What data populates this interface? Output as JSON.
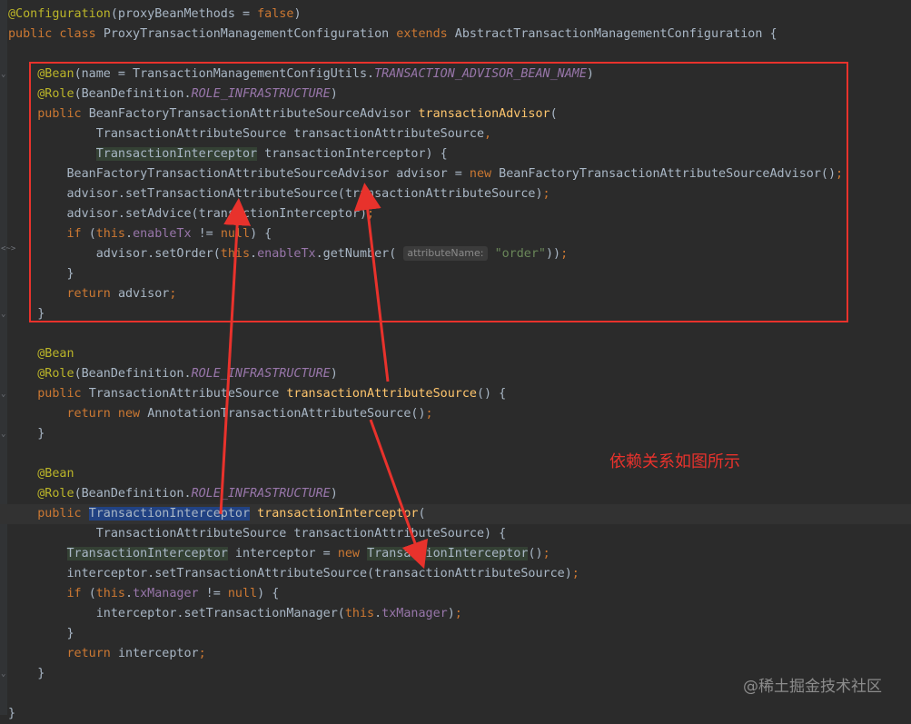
{
  "editor": {
    "lines": [
      [
        [
          "ann",
          "@Configuration"
        ],
        [
          "t",
          "(proxyBeanMethods = "
        ],
        [
          "kw",
          "false"
        ],
        [
          "t",
          ")"
        ]
      ],
      [
        [
          "kw",
          "public class "
        ],
        [
          "t",
          "ProxyTransactionManagementConfiguration "
        ],
        [
          "kw",
          "extends "
        ],
        [
          "t",
          "AbstractTransactionManagementConfiguration {"
        ]
      ],
      [],
      [
        [
          "t",
          "    "
        ],
        [
          "ann",
          "@Bean"
        ],
        [
          "t",
          "(name = TransactionManagementConfigUtils."
        ],
        [
          "cst",
          "TRANSACTION_ADVISOR_BEAN_NAME"
        ],
        [
          "t",
          ")"
        ]
      ],
      [
        [
          "t",
          "    "
        ],
        [
          "ann",
          "@Role"
        ],
        [
          "t",
          "(BeanDefinition."
        ],
        [
          "cst",
          "ROLE_INFRASTRUCTURE"
        ],
        [
          "t",
          ")"
        ]
      ],
      [
        [
          "t",
          "    "
        ],
        [
          "kw",
          "public "
        ],
        [
          "t",
          "BeanFactoryTransactionAttributeSourceAdvisor "
        ],
        [
          "meth",
          "transactionAdvisor"
        ],
        [
          "t",
          "("
        ]
      ],
      [
        [
          "t",
          "            TransactionAttributeSource transactionAttributeSource"
        ],
        [
          "kw",
          ","
        ]
      ],
      [
        [
          "t",
          "            "
        ],
        [
          "hl",
          "TransactionInterceptor"
        ],
        [
          "t",
          " transactionInterceptor) {"
        ]
      ],
      [
        [
          "t",
          "        BeanFactoryTransactionAttributeSourceAdvisor advisor = "
        ],
        [
          "kw",
          "new "
        ],
        [
          "t",
          "BeanFactoryTransactionAttributeSourceAdvisor()"
        ],
        [
          "kw",
          ";"
        ]
      ],
      [
        [
          "t",
          "        advisor.setTransactionAttributeSource(transactionAttributeSource)"
        ],
        [
          "kw",
          ";"
        ]
      ],
      [
        [
          "t",
          "        advisor.setAdvice(transactionInterceptor)"
        ],
        [
          "kw",
          ";"
        ]
      ],
      [
        [
          "t",
          "        "
        ],
        [
          "kw",
          "if "
        ],
        [
          "t",
          "("
        ],
        [
          "kw",
          "this"
        ],
        [
          "t",
          "."
        ],
        [
          "fld",
          "enableTx"
        ],
        [
          "t",
          " != "
        ],
        [
          "kw",
          "null"
        ],
        [
          "t",
          ") {"
        ]
      ],
      [
        [
          "t",
          "            advisor.setOrder("
        ],
        [
          "kw",
          "this"
        ],
        [
          "t",
          "."
        ],
        [
          "fld",
          "enableTx"
        ],
        [
          "t",
          "."
        ],
        [
          "fold",
          "<~>"
        ],
        [
          "t",
          "getNumber( "
        ],
        [
          "hint",
          "attributeName:"
        ],
        [
          "t",
          " "
        ],
        [
          "str",
          "\"order\""
        ],
        [
          "t",
          "))"
        ],
        [
          "kw",
          ";"
        ]
      ],
      [
        [
          "t",
          "        }"
        ]
      ],
      [
        [
          "t",
          "        "
        ],
        [
          "kw",
          "return "
        ],
        [
          "t",
          "advisor"
        ],
        [
          "kw",
          ";"
        ]
      ],
      [
        [
          "t",
          "    }"
        ]
      ],
      [],
      [
        [
          "t",
          "    "
        ],
        [
          "ann",
          "@Bean"
        ]
      ],
      [
        [
          "t",
          "    "
        ],
        [
          "ann",
          "@Role"
        ],
        [
          "t",
          "(BeanDefinition."
        ],
        [
          "cst",
          "ROLE_INFRASTRUCTURE"
        ],
        [
          "t",
          ")"
        ]
      ],
      [
        [
          "t",
          "    "
        ],
        [
          "kw",
          "public "
        ],
        [
          "t",
          "TransactionAttributeSource "
        ],
        [
          "meth",
          "transactionAttributeSource"
        ],
        [
          "t",
          "() {"
        ]
      ],
      [
        [
          "t",
          "        "
        ],
        [
          "kw",
          "return new "
        ],
        [
          "t",
          "AnnotationTransactionAttributeSource()"
        ],
        [
          "kw",
          ";"
        ]
      ],
      [
        [
          "t",
          "    }"
        ]
      ],
      [],
      [
        [
          "t",
          "    "
        ],
        [
          "ann",
          "@Bean"
        ]
      ],
      [
        [
          "t",
          "    "
        ],
        [
          "ann",
          "@Role"
        ],
        [
          "t",
          "(BeanDefinition."
        ],
        [
          "cst",
          "ROLE_INFRASTRUCTURE"
        ],
        [
          "t",
          ")"
        ]
      ],
      [
        [
          "t",
          "    "
        ],
        [
          "kw",
          "public "
        ],
        [
          "sel",
          "TransactionInterceptor"
        ],
        [
          "t",
          " "
        ],
        [
          "meth",
          "transactionInterceptor"
        ],
        [
          "t",
          "("
        ]
      ],
      [
        [
          "t",
          "            TransactionAttributeSource transactionAttributeSource) {"
        ]
      ],
      [
        [
          "t",
          "        "
        ],
        [
          "hl",
          "TransactionInterceptor"
        ],
        [
          "t",
          " interceptor = "
        ],
        [
          "kw",
          "new "
        ],
        [
          "hl",
          "TransactionInterceptor"
        ],
        [
          "t",
          "()"
        ],
        [
          "kw",
          ";"
        ]
      ],
      [
        [
          "t",
          "        interceptor.setTransactionAttributeSource(transactionAttributeSource)"
        ],
        [
          "kw",
          ";"
        ]
      ],
      [
        [
          "t",
          "        "
        ],
        [
          "kw",
          "if "
        ],
        [
          "t",
          "("
        ],
        [
          "kw",
          "this"
        ],
        [
          "t",
          "."
        ],
        [
          "fld",
          "txManager"
        ],
        [
          "t",
          " != "
        ],
        [
          "kw",
          "null"
        ],
        [
          "t",
          ") {"
        ]
      ],
      [
        [
          "t",
          "            interceptor.setTransactionManager("
        ],
        [
          "kw",
          "this"
        ],
        [
          "t",
          "."
        ],
        [
          "fld",
          "txManager"
        ],
        [
          "t",
          ")"
        ],
        [
          "kw",
          ";"
        ]
      ],
      [
        [
          "t",
          "        }"
        ]
      ],
      [
        [
          "t",
          "        "
        ],
        [
          "kw",
          "return "
        ],
        [
          "t",
          "interceptor"
        ],
        [
          "kw",
          ";"
        ]
      ],
      [
        [
          "t",
          "    }"
        ]
      ],
      [],
      [
        [
          "t",
          "}"
        ]
      ]
    ]
  },
  "annotation": {
    "note": "依赖关系如图所示",
    "color": "#e8322c"
  },
  "watermark": "@稀土掘金技术社区"
}
